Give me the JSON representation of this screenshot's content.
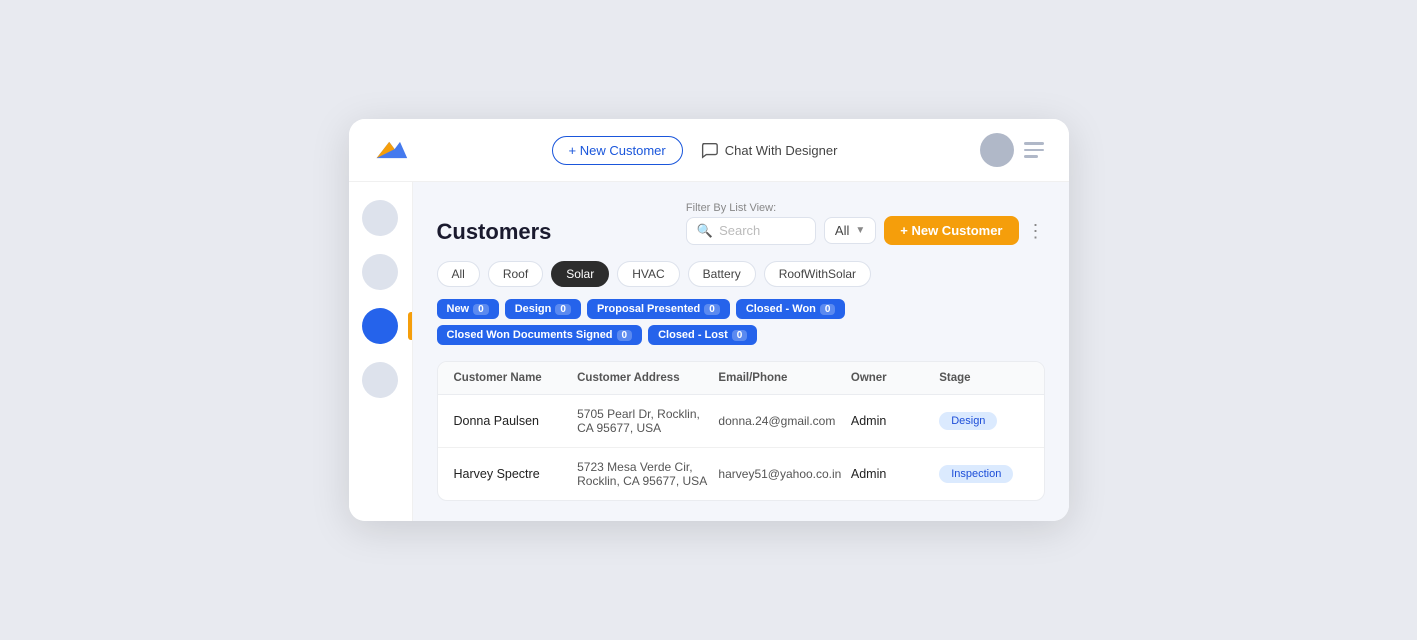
{
  "topbar": {
    "new_customer_outline_label": "+ New Customer",
    "chat_label": "Chat With Designer"
  },
  "page": {
    "title": "Customers"
  },
  "filters": {
    "filter_by_label": "Filter By List View:",
    "search_placeholder": "Search",
    "list_view_default": "All",
    "new_customer_label": "+ New Customer"
  },
  "type_tabs": [
    {
      "label": "All",
      "active": false
    },
    {
      "label": "Roof",
      "active": false
    },
    {
      "label": "Solar",
      "active": true
    },
    {
      "label": "HVAC",
      "active": false
    },
    {
      "label": "Battery",
      "active": false
    },
    {
      "label": "RoofWithSolar",
      "active": false
    }
  ],
  "stage_pills": [
    {
      "label": "New",
      "count": "0"
    },
    {
      "label": "Design",
      "count": "0"
    },
    {
      "label": "Proposal Presented",
      "count": "0"
    },
    {
      "label": "Closed - Won",
      "count": "0"
    },
    {
      "label": "Closed Won Documents Signed",
      "count": "0"
    },
    {
      "label": "Closed - Lost",
      "count": "0"
    }
  ],
  "table": {
    "headers": [
      "Customer Name",
      "Customer Address",
      "Email/Phone",
      "Owner",
      "Stage"
    ],
    "rows": [
      {
        "name": "Donna Paulsen",
        "address": "5705 Pearl Dr, Rocklin, CA 95677, USA",
        "email": "donna.24@gmail.com",
        "owner": "Admin",
        "stage": "Design",
        "stage_class": "design"
      },
      {
        "name": "Harvey Spectre",
        "address": "5723 Mesa Verde Cir, Rocklin, CA 95677, USA",
        "email": "harvey51@yahoo.co.in",
        "owner": "Admin",
        "stage": "Inspection",
        "stage_class": "inspection"
      }
    ]
  }
}
